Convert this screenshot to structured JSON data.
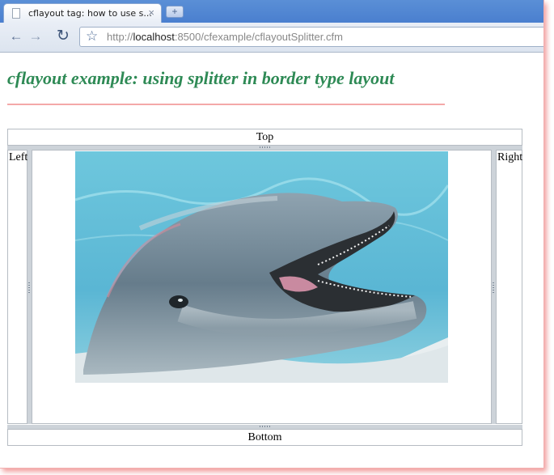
{
  "browser": {
    "tab_title": "cflayout tag: how to use s...",
    "close_glyph": "×",
    "newtab_glyph": "+",
    "url_prefix": "http://",
    "url_host": "localhost",
    "url_rest": ":8500/cfexample/cflayoutSplitter.cfm"
  },
  "page": {
    "heading": "cflayout example: using splitter in border type layout",
    "heading_color": "#2e8a55",
    "rule_color": "#f4a8a8"
  },
  "layout": {
    "top": "Top",
    "left": "Left",
    "right": "Right",
    "bottom": "Bottom",
    "center_image": "dolphin photo"
  }
}
